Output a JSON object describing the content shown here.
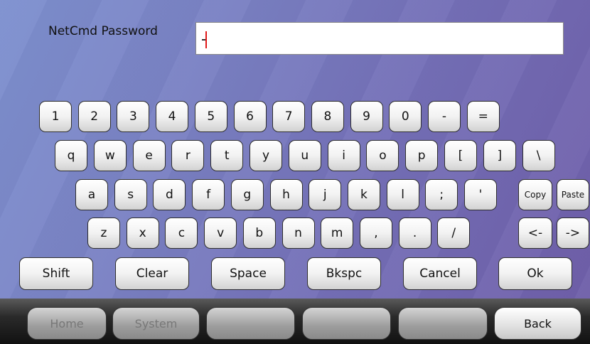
{
  "password_field": {
    "label": "NetCmd Password",
    "value": ""
  },
  "keyboard": {
    "row_numbers": [
      "1",
      "2",
      "3",
      "4",
      "5",
      "6",
      "7",
      "8",
      "9",
      "0",
      "-",
      "="
    ],
    "row_top": [
      "q",
      "w",
      "e",
      "r",
      "t",
      "y",
      "u",
      "i",
      "o",
      "p",
      "[",
      "]",
      "\\"
    ],
    "row_home": [
      "a",
      "s",
      "d",
      "f",
      "g",
      "h",
      "j",
      "k",
      "l",
      ";",
      "'"
    ],
    "row_bottom": [
      "z",
      "x",
      "c",
      "v",
      "b",
      "n",
      "m",
      ",",
      ".",
      "/"
    ],
    "copy": "Copy",
    "paste": "Paste",
    "cursor_left": "<-",
    "cursor_right": "->",
    "actions": [
      "Shift",
      "Clear",
      "Space",
      "Bkspc",
      "Cancel",
      "Ok"
    ]
  },
  "navbar": {
    "home": "Home",
    "system": "System",
    "blank1": "",
    "blank2": "",
    "blank3": "",
    "back": "Back"
  }
}
